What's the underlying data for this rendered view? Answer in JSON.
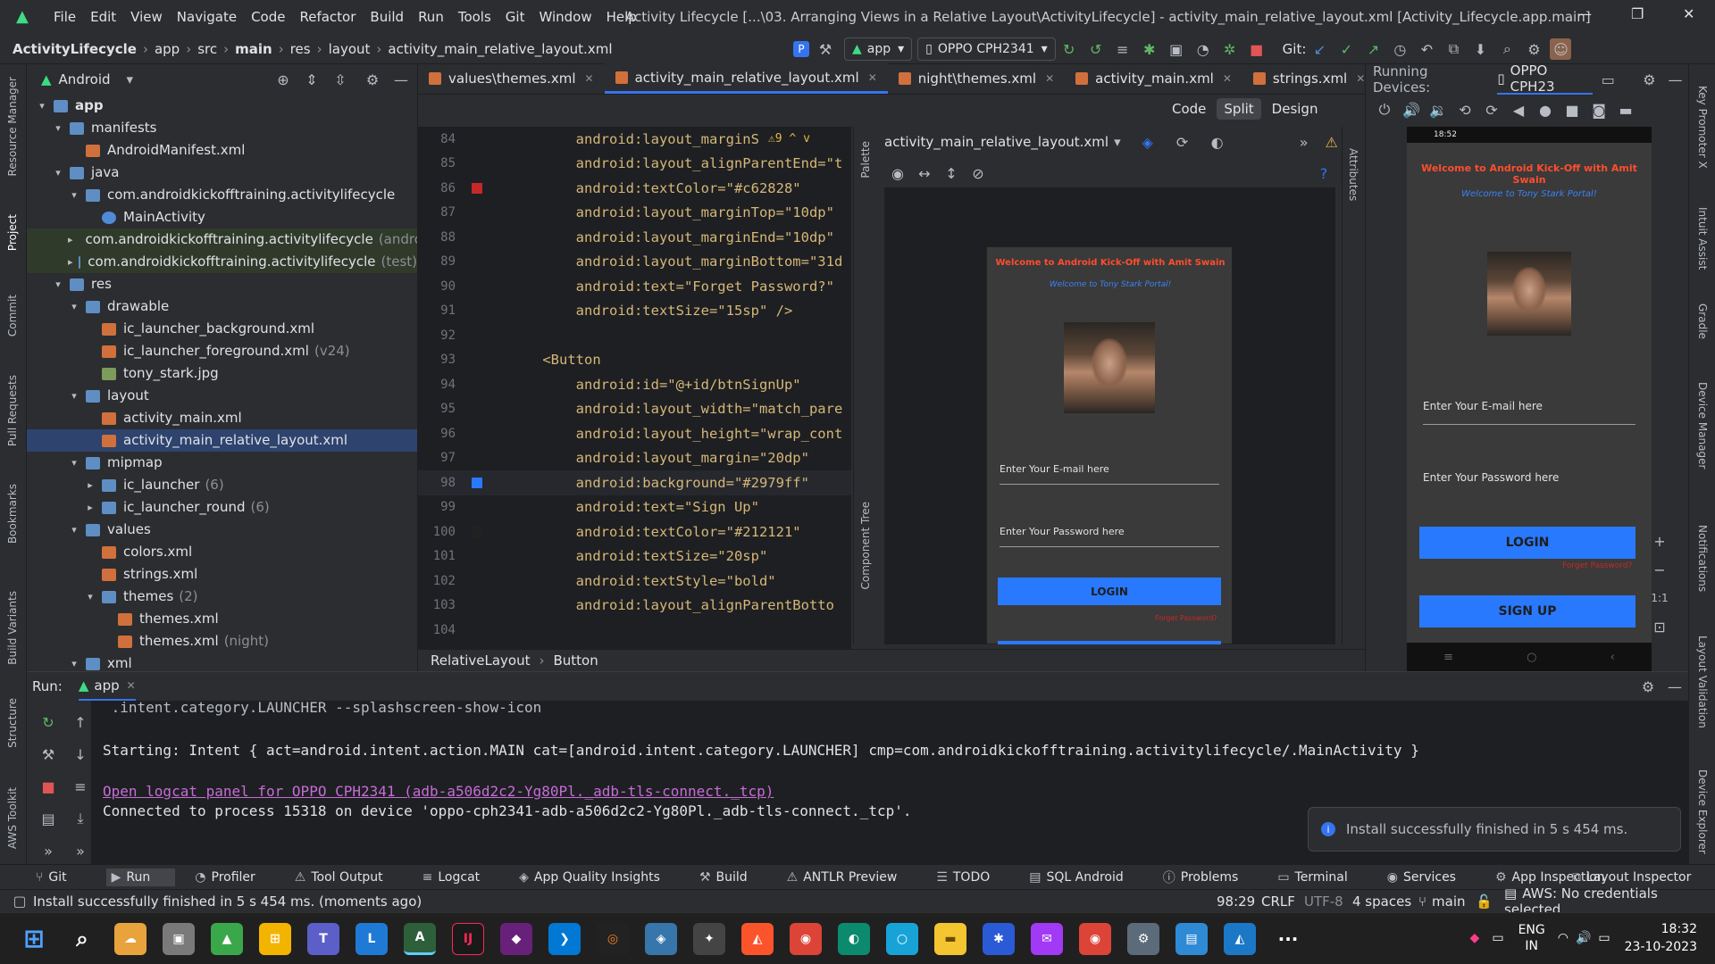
{
  "window": {
    "menu": [
      "File",
      "Edit",
      "View",
      "Navigate",
      "Code",
      "Refactor",
      "Build",
      "Run",
      "Tools",
      "Git",
      "Window",
      "Help"
    ],
    "title": "Activity Lifecycle [...\\03. Arranging Views in a Relative Layout\\ActivityLifecycle] - activity_main_relative_layout.xml [Activity_Lifecycle.app.main]"
  },
  "breadcrumb": [
    "ActivityLifecycle",
    "app",
    "src",
    "main",
    "res",
    "layout",
    "activity_main_relative_layout.xml"
  ],
  "toolbar": {
    "run_config": "app",
    "device": "OPPO CPH2341",
    "git_label": "Git:"
  },
  "project": {
    "view_label": "Android",
    "tree": [
      {
        "label": "app",
        "depth": 0,
        "type": "fold",
        "arrow": "open",
        "bold": true
      },
      {
        "label": "manifests",
        "depth": 1,
        "type": "fold",
        "arrow": "open"
      },
      {
        "label": "AndroidManifest.xml",
        "depth": 2,
        "type": "xml",
        "arrow": "none"
      },
      {
        "label": "java",
        "depth": 1,
        "type": "fold",
        "arrow": "open"
      },
      {
        "label": "com.androidkickofftraining.activitylifecycle",
        "depth": 2,
        "type": "fold",
        "arrow": "open"
      },
      {
        "label": "MainActivity",
        "depth": 3,
        "type": "cls",
        "arrow": "none"
      },
      {
        "label": "com.androidkickofftraining.activitylifecycle",
        "depth": 2,
        "type": "fold",
        "arrow": "closed",
        "suffix": "(androidTest)",
        "hl": true
      },
      {
        "label": "com.androidkickofftraining.activitylifecycle",
        "depth": 2,
        "type": "fold",
        "arrow": "closed",
        "suffix": "(test)",
        "hl": true
      },
      {
        "label": "res",
        "depth": 1,
        "type": "fold",
        "arrow": "open"
      },
      {
        "label": "drawable",
        "depth": 2,
        "type": "fold",
        "arrow": "open"
      },
      {
        "label": "ic_launcher_background.xml",
        "depth": 3,
        "type": "xml",
        "arrow": "none"
      },
      {
        "label": "ic_launcher_foreground.xml",
        "depth": 3,
        "type": "xml",
        "arrow": "none",
        "suffix": "(v24)"
      },
      {
        "label": "tony_stark.jpg",
        "depth": 3,
        "type": "img",
        "arrow": "none"
      },
      {
        "label": "layout",
        "depth": 2,
        "type": "fold",
        "arrow": "open"
      },
      {
        "label": "activity_main.xml",
        "depth": 3,
        "type": "xml",
        "arrow": "none"
      },
      {
        "label": "activity_main_relative_layout.xml",
        "depth": 3,
        "type": "xml",
        "arrow": "none",
        "sel": true
      },
      {
        "label": "mipmap",
        "depth": 2,
        "type": "fold",
        "arrow": "open"
      },
      {
        "label": "ic_launcher",
        "depth": 3,
        "type": "fold",
        "arrow": "closed",
        "suffix": "(6)"
      },
      {
        "label": "ic_launcher_round",
        "depth": 3,
        "type": "fold",
        "arrow": "closed",
        "suffix": "(6)"
      },
      {
        "label": "values",
        "depth": 2,
        "type": "fold",
        "arrow": "open"
      },
      {
        "label": "colors.xml",
        "depth": 3,
        "type": "xml",
        "arrow": "none"
      },
      {
        "label": "strings.xml",
        "depth": 3,
        "type": "xml",
        "arrow": "none"
      },
      {
        "label": "themes",
        "depth": 3,
        "type": "fold",
        "arrow": "open",
        "suffix": "(2)"
      },
      {
        "label": "themes.xml",
        "depth": 4,
        "type": "xml",
        "arrow": "none"
      },
      {
        "label": "themes.xml",
        "depth": 4,
        "type": "xml",
        "arrow": "none",
        "suffix": "(night)"
      },
      {
        "label": "xml",
        "depth": 2,
        "type": "fold",
        "arrow": "open"
      }
    ]
  },
  "editor_tabs": [
    "values\\themes.xml",
    "activity_main_relative_layout.xml",
    "night\\themes.xml",
    "activity_main.xml",
    "strings.xml"
  ],
  "active_tab": 1,
  "view_modes": [
    "Code",
    "Split",
    "Design"
  ],
  "code": [
    {
      "n": "84",
      "text": "        android:layout_marginS",
      "extra": "⚠9 ^ v"
    },
    {
      "n": "85",
      "text": "        android:layout_alignParentEnd=\"t"
    },
    {
      "n": "86",
      "text": "        android:textColor=\"#c62828\"",
      "mark": "#c62828"
    },
    {
      "n": "87",
      "text": "        android:layout_marginTop=\"10dp\""
    },
    {
      "n": "88",
      "text": "        android:layout_marginEnd=\"10dp\""
    },
    {
      "n": "89",
      "text": "        android:layout_marginBottom=\"31d"
    },
    {
      "n": "90",
      "text": "        android:text=\"Forget Password?\""
    },
    {
      "n": "91",
      "text": "        android:textSize=\"15sp\" />"
    },
    {
      "n": "92",
      "text": ""
    },
    {
      "n": "93",
      "text": "    <Button"
    },
    {
      "n": "94",
      "text": "        android:id=\"@+id/btnSignUp\""
    },
    {
      "n": "95",
      "text": "        android:layout_width=\"match_pare"
    },
    {
      "n": "96",
      "text": "        android:layout_height=\"wrap_cont"
    },
    {
      "n": "97",
      "text": "        android:layout_margin=\"20dp\""
    },
    {
      "n": "98",
      "text": "        android:background=\"#2979ff\"",
      "mark": "#2979ff"
    },
    {
      "n": "99",
      "text": "        android:text=\"Sign Up\""
    },
    {
      "n": "100",
      "text": "        android:textColor=\"#212121\"",
      "mark": "#212121"
    },
    {
      "n": "101",
      "text": "        android:textSize=\"20sp\""
    },
    {
      "n": "102",
      "text": "        android:textStyle=\"bold\""
    },
    {
      "n": "103",
      "text": "        android:layout_alignParentBotto"
    },
    {
      "n": "104",
      "text": ""
    }
  ],
  "design": {
    "file_selector": "activity_main_relative_layout.xml",
    "palette": "Palette",
    "component_tree": "Component Tree",
    "attributes": "Attributes"
  },
  "app_preview": {
    "welcome": "Welcome to Android Kick-Off with Amit Swain",
    "subtitle": "Welcome to Tony Stark Portal!",
    "email_hint": "Enter Your E-mail here",
    "password_hint": "Enter Your Password here",
    "login": "LOGIN",
    "signup": "SIGN UP",
    "forgot": "Forget Password?"
  },
  "running_devices": {
    "label": "Running Devices:",
    "device_tab": "OPPO CPH23",
    "status_time": "18:52"
  },
  "zoom": {
    "plus": "+",
    "minus": "−",
    "oneone": "1:1"
  },
  "status_path": [
    "RelativeLayout",
    "Button"
  ],
  "run": {
    "label": "Run:",
    "tab": "app",
    "lines": [
      " .intent.category.LAUNCHER --splashscreen-show-icon",
      "Starting: Intent { act=android.intent.action.MAIN cat=[android.intent.category.LAUNCHER] cmp=com.androidkickofftraining.activitylifecycle/.MainActivity }",
      "Open logcat panel for OPPO CPH2341 (adb-a506d2c2-Yg80Pl._adb-tls-connect._tcp)",
      "Connected to process 15318 on device 'oppo-cph2341-adb-a506d2c2-Yg80Pl._adb-tls-connect._tcp'."
    ]
  },
  "toast": "Install successfully finished in 5 s 454 ms.",
  "bottom_tools": [
    "Git",
    "Run",
    "Profiler",
    "Tool Output",
    "Logcat",
    "App Quality Insights",
    "Build",
    "ANTLR Preview",
    "TODO",
    "SQL Android",
    "Problems",
    "Terminal",
    "Services",
    "App Inspection"
  ],
  "layout_inspector": "Layout Inspector",
  "left_strip": [
    "Resource Manager",
    "Project",
    "Commit",
    "Pull Requests",
    "Bookmarks",
    "Build Variants",
    "Structure",
    "AWS Toolkit"
  ],
  "right_strip": [
    "Key Promoter X",
    "Intuit Assist",
    "Gradle",
    "Device Manager",
    "Notifications",
    "Layout Validation",
    "Device Explorer"
  ],
  "status": {
    "message": "Install successfully finished in 5 s 454 ms. (moments ago)",
    "position": "98:29",
    "line_sep": "CRLF",
    "encoding": "UTF-8",
    "indent": "4 spaces",
    "branch": "main",
    "aws": "AWS: No credentials selected"
  },
  "taskbar": {
    "lang": "ENG",
    "region": "IN",
    "time": "18:32",
    "date": "23-10-2023"
  }
}
